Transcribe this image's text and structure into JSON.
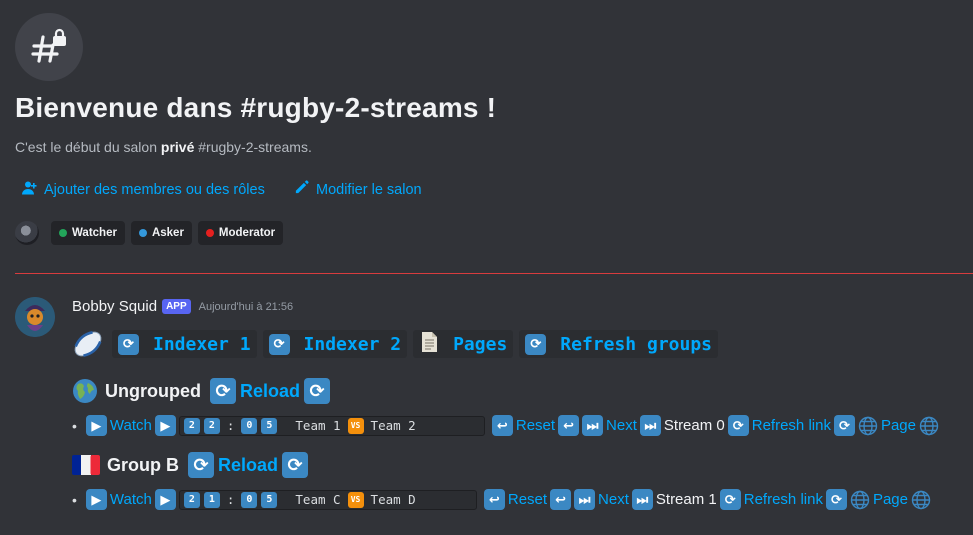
{
  "welcome": {
    "title": "Bienvenue dans #rugby-2-streams !",
    "subtitle_prefix": "C'est le début du salon ",
    "subtitle_bold": "privé",
    "subtitle_suffix": " #rugby-2-streams."
  },
  "actions": {
    "add_members": "Ajouter des membres ou des rôles",
    "edit_channel": "Modifier le salon"
  },
  "roles": [
    {
      "name": "Watcher",
      "color": "#23a55a"
    },
    {
      "name": "Asker",
      "color": "#3498db"
    },
    {
      "name": "Moderator",
      "color": "#e5201f"
    }
  ],
  "message": {
    "author": "Bobby Squid",
    "badge": "APP",
    "timestamp": "Aujourd'hui à 21:56",
    "indexer_buttons": [
      {
        "label": "Indexer 1",
        "icon": "refresh-icon"
      },
      {
        "label": "Indexer 2",
        "icon": "refresh-icon"
      },
      {
        "label": "Pages",
        "icon": "page-icon"
      },
      {
        "label": "Refresh groups",
        "icon": "refresh-icon"
      }
    ],
    "groups": [
      {
        "name": "Ungrouped",
        "icon": "globe-icon",
        "reload_label": "Reload",
        "stream": {
          "watch": "Watch",
          "time": [
            "2",
            "2",
            "0",
            "5"
          ],
          "team_a": "Team 1",
          "team_b": "Team 2",
          "reset": "Reset",
          "next": "Next",
          "stream_label": "Stream 0",
          "refresh": "Refresh link",
          "page": "Page"
        }
      },
      {
        "name": "Group B",
        "icon": "france-flag-icon",
        "reload_label": "Reload",
        "stream": {
          "watch": "Watch",
          "time": [
            "2",
            "1",
            "0",
            "5"
          ],
          "team_a": "Team C",
          "team_b": "Team D",
          "reset": "Reset",
          "next": "Next",
          "stream_label": "Stream 1",
          "refresh": "Refresh link",
          "page": "Page"
        }
      }
    ]
  },
  "colors": {
    "link": "#00a8fc",
    "background": "#313338",
    "keycap": "#3b88c3",
    "vs_badge": "#f4900c",
    "divider": "#d83c3e"
  },
  "icons": {
    "vs": "VS"
  }
}
